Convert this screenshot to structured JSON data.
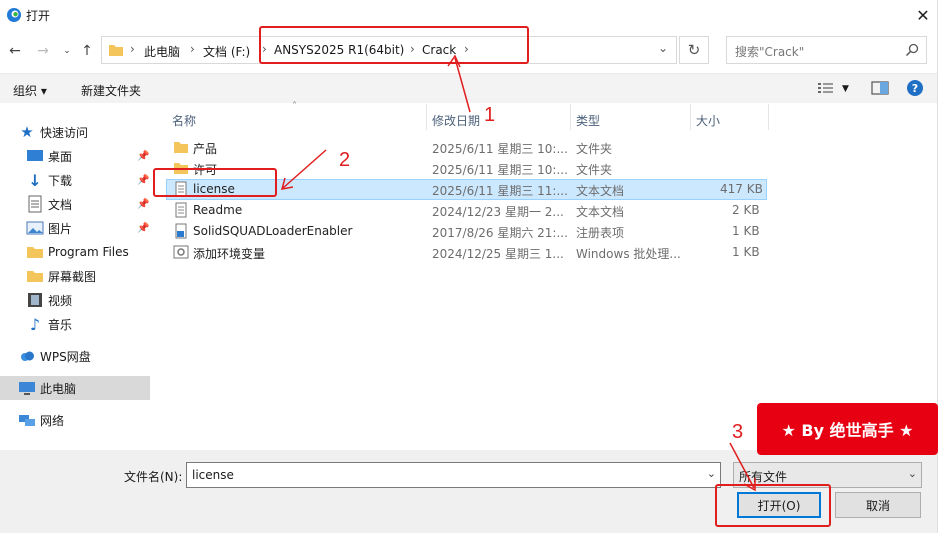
{
  "window": {
    "title": "打开"
  },
  "address": {
    "crumbs": [
      "此电脑",
      "文档 (F:)",
      "ANSYS2025 R1(64bit)",
      "Crack"
    ]
  },
  "search": {
    "placeholder": "搜索\"Crack\""
  },
  "toolbar": {
    "organize": "组织 ▾",
    "new_folder": "新建文件夹"
  },
  "sidebar": {
    "items": [
      {
        "label": "快速访问",
        "icon": "star-icon"
      },
      {
        "label": "桌面",
        "icon": "desktop-icon",
        "pinned": true
      },
      {
        "label": "下载",
        "icon": "download-icon",
        "pinned": true
      },
      {
        "label": "文档",
        "icon": "document-icon",
        "pinned": true
      },
      {
        "label": "图片",
        "icon": "picture-icon",
        "pinned": true
      },
      {
        "label": "Program Files",
        "icon": "folder-icon"
      },
      {
        "label": "屏幕截图",
        "icon": "folder-icon"
      },
      {
        "label": "视频",
        "icon": "video-icon"
      },
      {
        "label": "音乐",
        "icon": "music-icon"
      },
      {
        "label": "WPS网盘",
        "icon": "cloud-icon"
      },
      {
        "label": "此电脑",
        "icon": "computer-icon",
        "selected": true
      },
      {
        "label": "网络",
        "icon": "network-icon"
      }
    ]
  },
  "columns": [
    "名称",
    "修改日期",
    "类型",
    "大小"
  ],
  "files": [
    {
      "name": "产品",
      "date": "2025/6/11 星期三 10:...",
      "type": "文件夹",
      "size": "",
      "icon": "folder-icon"
    },
    {
      "name": "许可",
      "date": "2025/6/11 星期三 10:...",
      "type": "文件夹",
      "size": "",
      "icon": "folder-icon"
    },
    {
      "name": "license",
      "date": "2025/6/11 星期三 11:...",
      "type": "文本文档",
      "size": "417 KB",
      "icon": "text-file-icon",
      "selected": true
    },
    {
      "name": "Readme",
      "date": "2024/12/23 星期一 2...",
      "type": "文本文档",
      "size": "2 KB",
      "icon": "text-file-icon"
    },
    {
      "name": "SolidSQUADLoaderEnabler",
      "date": "2017/8/26 星期六 21:...",
      "type": "注册表项",
      "size": "1 KB",
      "icon": "registry-icon"
    },
    {
      "name": "添加环境变量",
      "date": "2024/12/25 星期三 1...",
      "type": "Windows 批处理...",
      "size": "1 KB",
      "icon": "batch-file-icon"
    }
  ],
  "bottom": {
    "filename_label": "文件名(N):",
    "filename_value": "license",
    "filetype_value": "所有文件",
    "open_label": "打开(O)",
    "cancel_label": "取消"
  },
  "annotations": {
    "n1": "1",
    "n2": "2",
    "n3": "3",
    "color": "#e11e1e"
  },
  "watermark": {
    "text": "★ By 绝世高手 ★",
    "color": "#e60012"
  }
}
